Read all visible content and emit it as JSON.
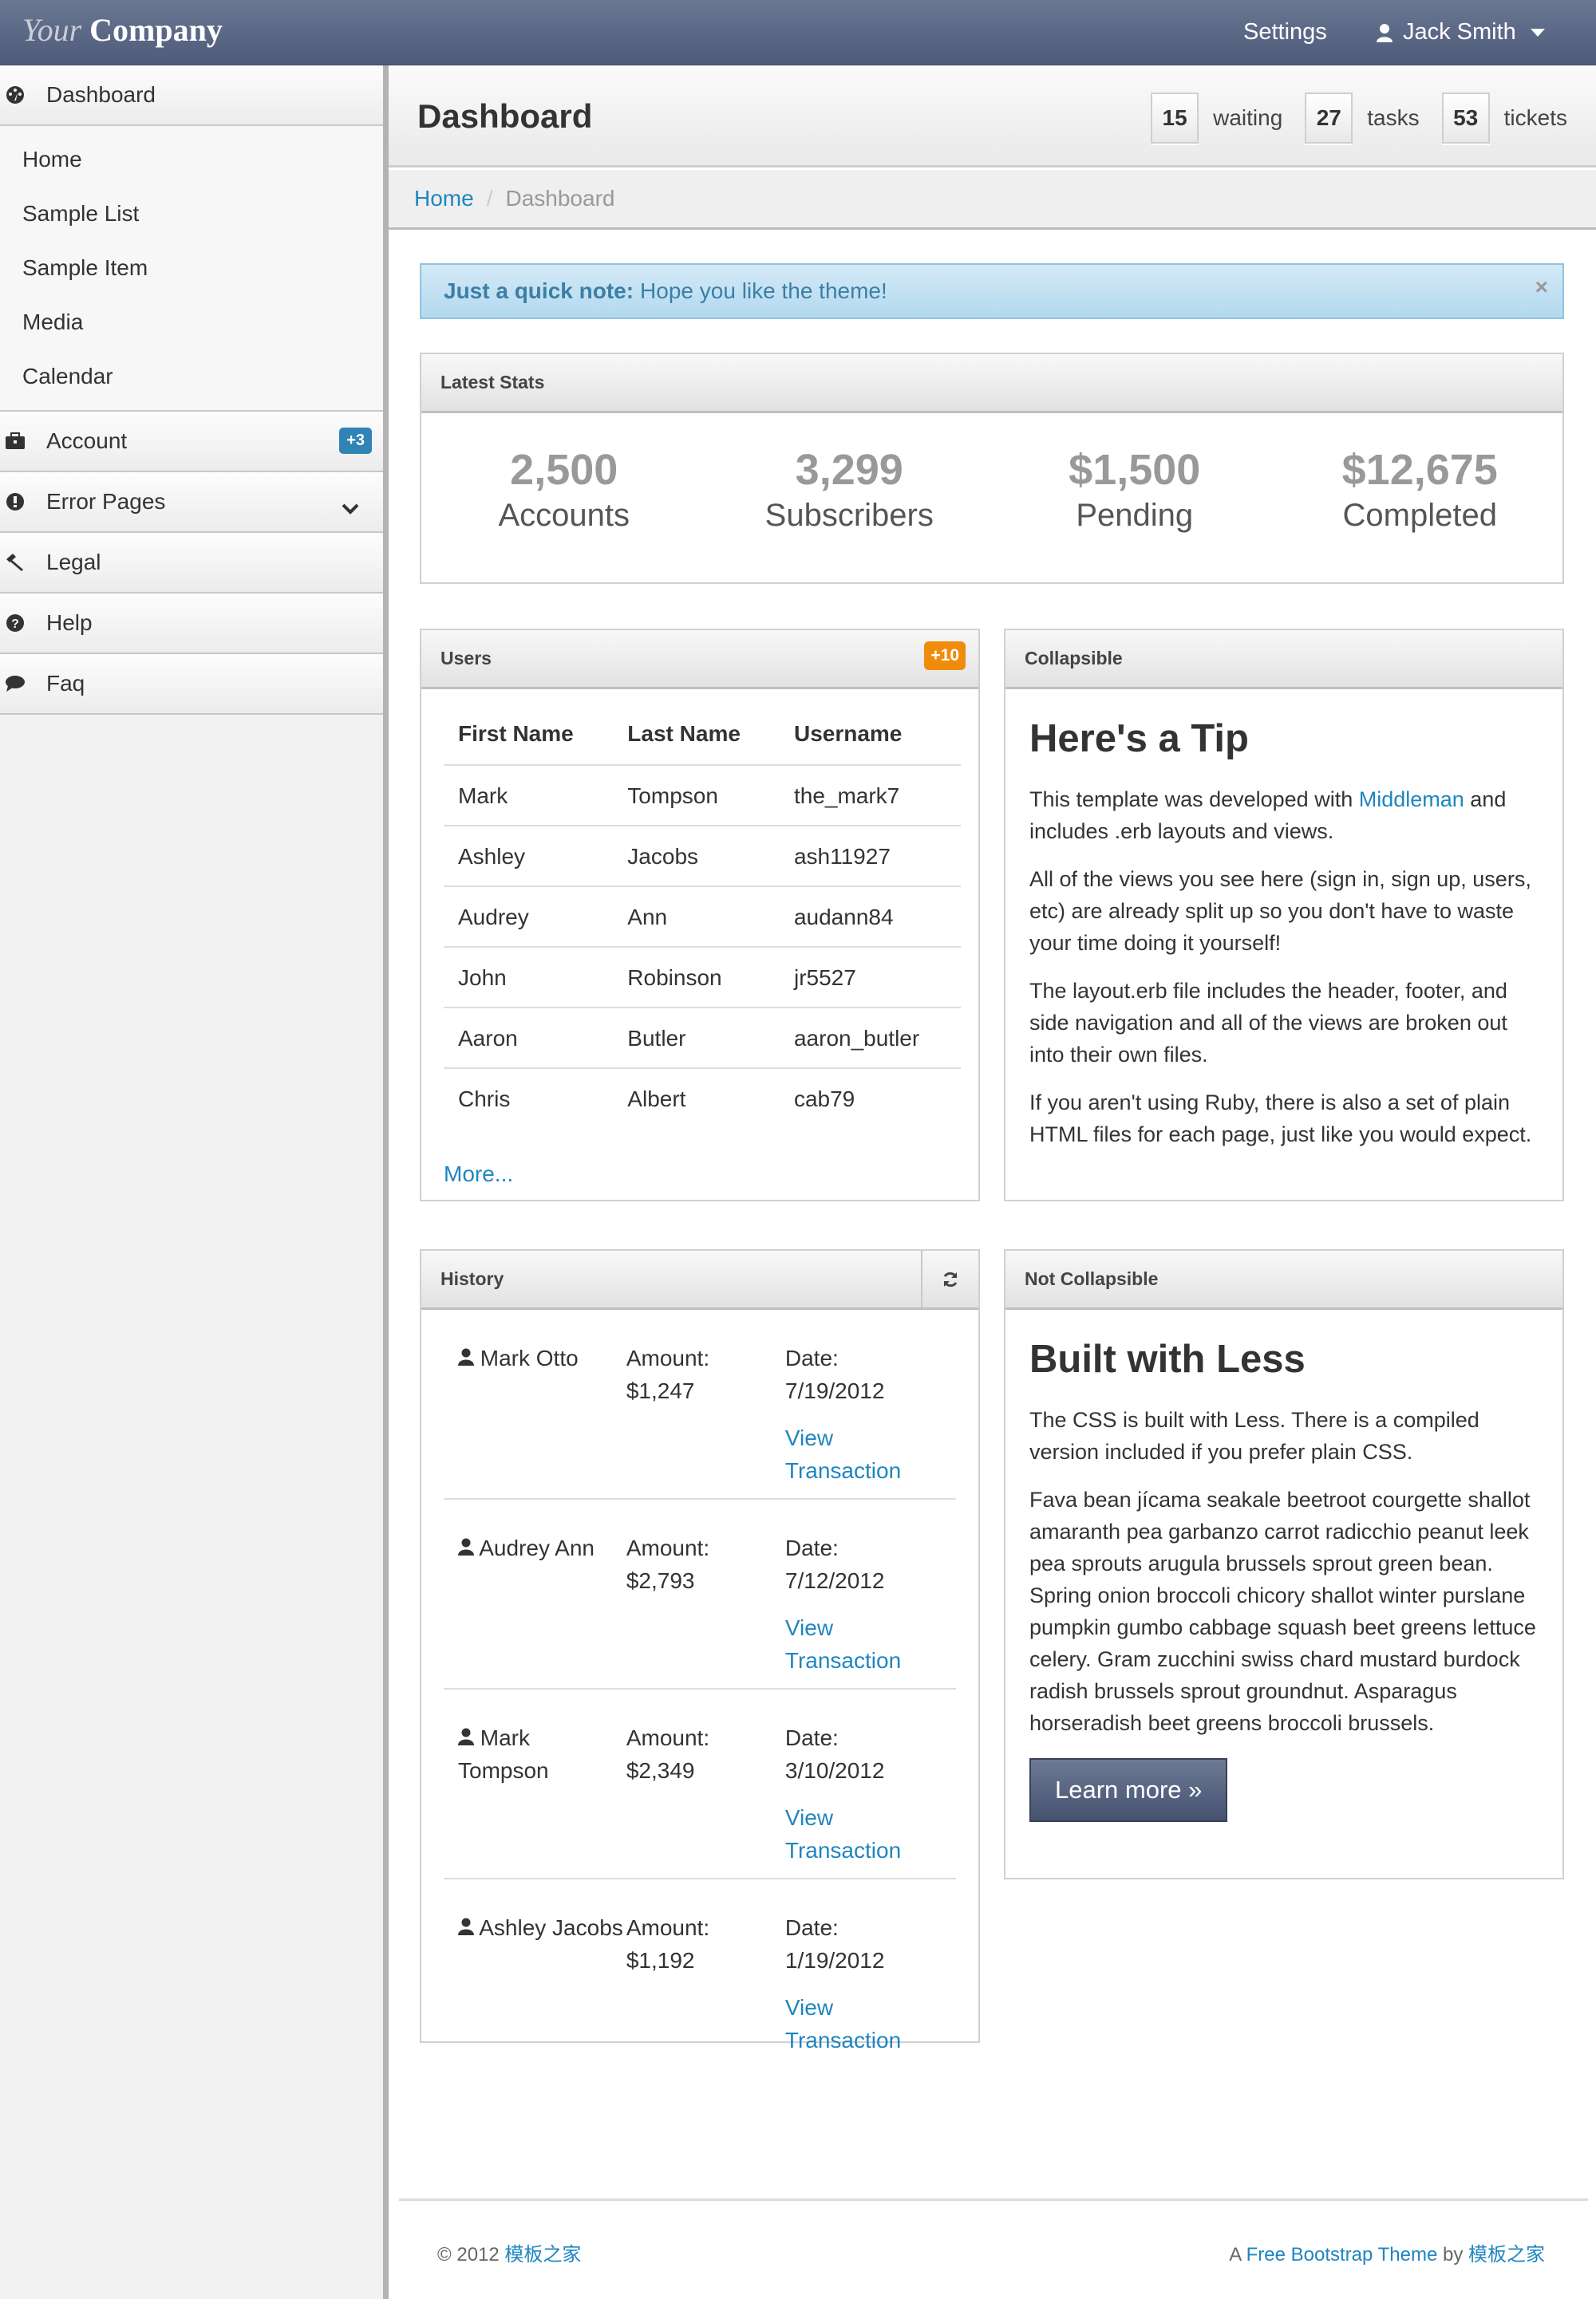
{
  "navbar": {
    "brand_your": "Your",
    "brand_company": "Company",
    "settings": "Settings",
    "user_name": "Jack Smith"
  },
  "sidebar": {
    "dashboard": {
      "label": "Dashboard",
      "icon": "dashboard-icon"
    },
    "sub_items": [
      "Home",
      "Sample List",
      "Sample Item",
      "Media",
      "Calendar"
    ],
    "account": {
      "label": "Account",
      "icon": "briefcase-icon",
      "badge": "+3"
    },
    "error_pages": {
      "label": "Error Pages",
      "icon": "exclamation-icon"
    },
    "legal": {
      "label": "Legal",
      "icon": "gavel-icon"
    },
    "help": {
      "label": "Help",
      "icon": "question-icon"
    },
    "faq": {
      "label": "Faq",
      "icon": "comment-icon"
    }
  },
  "header": {
    "title": "Dashboard",
    "counters": [
      {
        "value": "15",
        "label": "waiting"
      },
      {
        "value": "27",
        "label": "tasks"
      },
      {
        "value": "53",
        "label": "tickets"
      }
    ]
  },
  "breadcrumb": {
    "home": "Home",
    "separator": "/",
    "current": "Dashboard"
  },
  "alert": {
    "strong": "Just a quick note:",
    "text": "Hope you like the theme!",
    "close": "×"
  },
  "stats": {
    "title": "Latest Stats",
    "items": [
      {
        "value": "2,500",
        "label": "Accounts"
      },
      {
        "value": "3,299",
        "label": "Subscribers"
      },
      {
        "value": "$1,500",
        "label": "Pending"
      },
      {
        "value": "$12,675",
        "label": "Completed"
      }
    ]
  },
  "users": {
    "title": "Users",
    "badge": "+10",
    "columns": [
      "First Name",
      "Last Name",
      "Username"
    ],
    "rows": [
      [
        "Mark",
        "Tompson",
        "the_mark7"
      ],
      [
        "Ashley",
        "Jacobs",
        "ash11927"
      ],
      [
        "Audrey",
        "Ann",
        "audann84"
      ],
      [
        "John",
        "Robinson",
        "jr5527"
      ],
      [
        "Aaron",
        "Butler",
        "aaron_butler"
      ],
      [
        "Chris",
        "Albert",
        "cab79"
      ]
    ],
    "more": "More..."
  },
  "collapsible": {
    "title": "Collapsible",
    "heading": "Here's a Tip",
    "p1_before": "This template was developed with ",
    "p1_link": "Middleman",
    "p1_after": " and includes .erb layouts and views.",
    "p2": "All of the views you see here (sign in, sign up, users, etc) are already split up so you don't have to waste your time doing it yourself!",
    "p3": "The layout.erb file includes the header, footer, and side navigation and all of the views are broken out into their own files.",
    "p4": "If you aren't using Ruby, there is also a set of plain HTML files for each page, just like you would expect."
  },
  "history": {
    "title": "History",
    "amount_label": "Amount:",
    "date_label": "Date:",
    "link": "View Transaction",
    "rows": [
      {
        "name": "Mark Otto",
        "amount": "$1,247",
        "date": "7/19/2012"
      },
      {
        "name": "Audrey Ann",
        "amount": "$2,793",
        "date": "7/12/2012"
      },
      {
        "name": "Mark Tompson",
        "amount": "$2,349",
        "date": "3/10/2012"
      },
      {
        "name": "Ashley Jacobs",
        "amount": "$1,192",
        "date": "1/19/2012"
      }
    ]
  },
  "not_collapsible": {
    "title": "Not Collapsible",
    "heading": "Built with Less",
    "p1": "The CSS is built with Less. There is a compiled version included if you prefer plain CSS.",
    "p2": "Fava bean jícama seakale beetroot courgette shallot amaranth pea garbanzo carrot radicchio peanut leek pea sprouts arugula brussels sprout green bean. Spring onion broccoli chicory shallot winter purslane pumpkin gumbo cabbage squash beet greens lettuce celery. Gram zucchini swiss chard mustard burdock radish brussels sprout groundnut. Asparagus horseradish beet greens broccoli brussels.",
    "button": "Learn more »"
  },
  "footer": {
    "copyright": "© 2012",
    "left_link": "模板之家",
    "right_prefix": "A",
    "right_link": "Free Bootstrap Theme",
    "right_by": "by",
    "right_link2": "模板之家"
  },
  "colors": {
    "navbar": "#5a6785",
    "link": "#1f85c0",
    "badge_blue": "#2f84b5",
    "badge_orange": "#f08c0c",
    "alert_bg": "#c3e1f3"
  }
}
